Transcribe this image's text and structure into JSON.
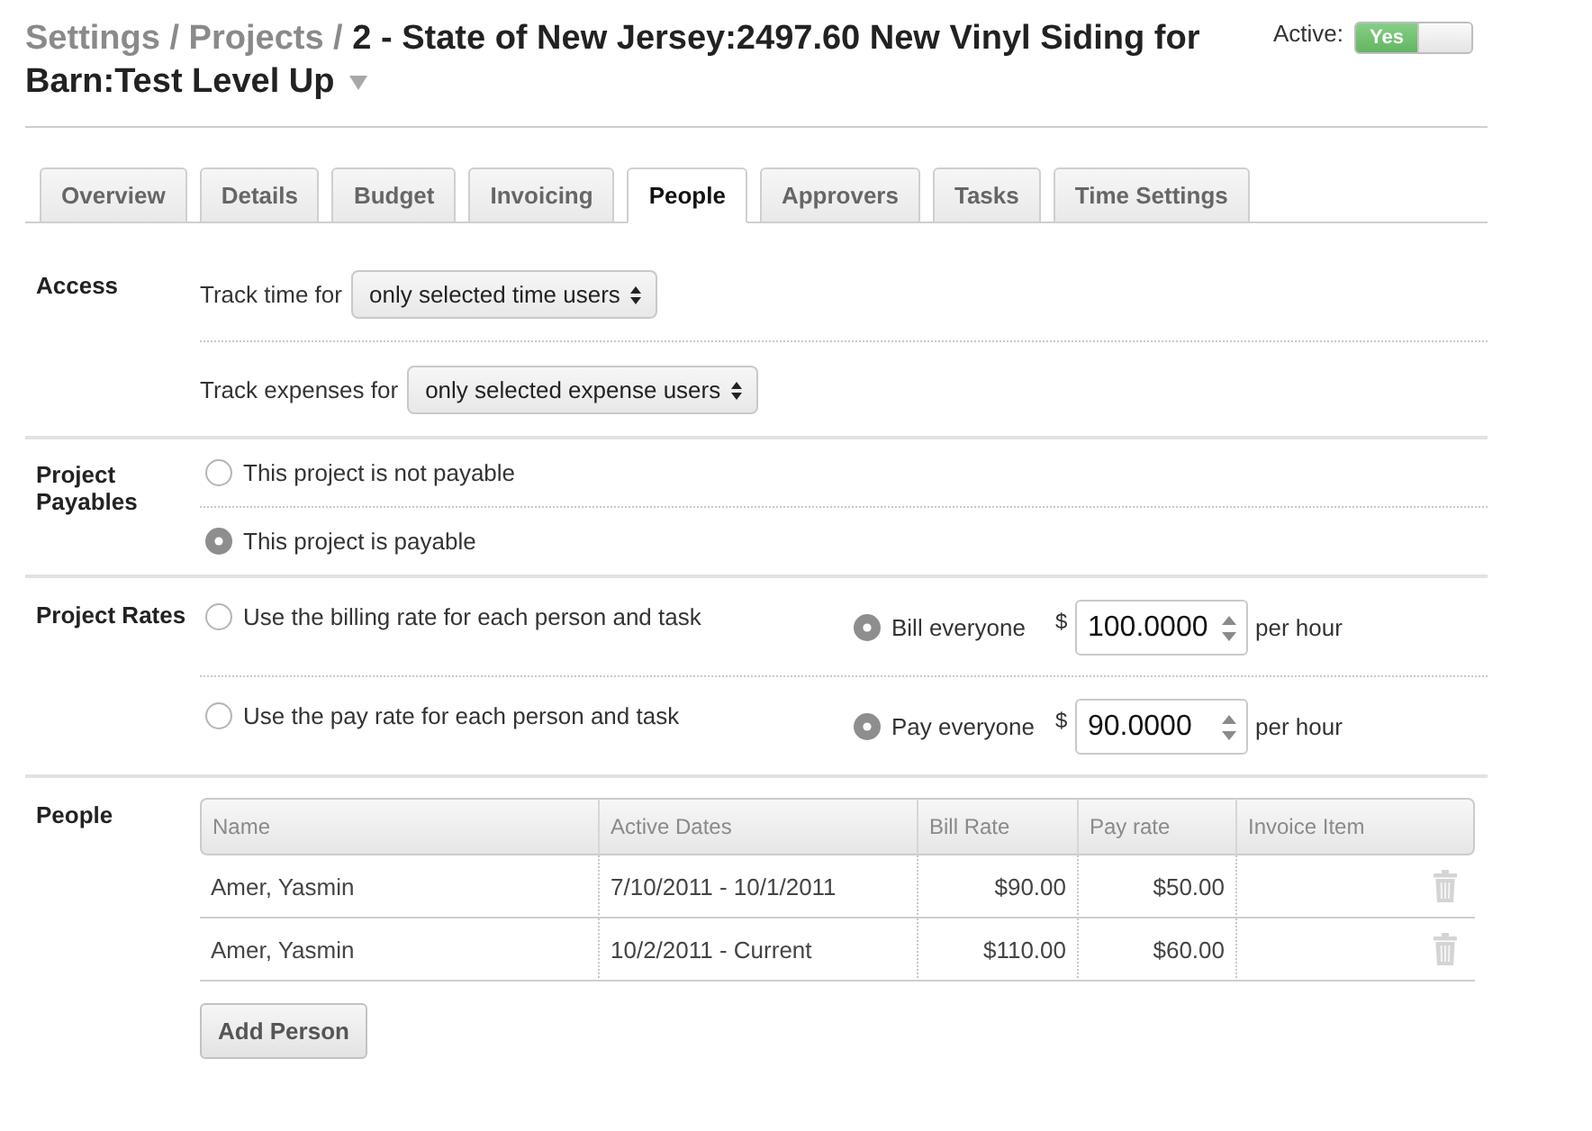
{
  "header": {
    "breadcrumb": [
      {
        "label": "Settings",
        "separator": "/"
      },
      {
        "label": "Projects",
        "separator": "/"
      }
    ],
    "title": "2 - State of New Jersey:2497.60 New Vinyl Siding for Barn:Test Level Up",
    "active": {
      "label": "Active:",
      "on": true,
      "on_text": "Yes"
    }
  },
  "tabs": [
    {
      "label": "Overview",
      "selected": false
    },
    {
      "label": "Details",
      "selected": false
    },
    {
      "label": "Budget",
      "selected": false
    },
    {
      "label": "Invoicing",
      "selected": false
    },
    {
      "label": "People",
      "selected": true
    },
    {
      "label": "Approvers",
      "selected": false
    },
    {
      "label": "Tasks",
      "selected": false
    },
    {
      "label": "Time Settings",
      "selected": false
    }
  ],
  "access": {
    "label": "Access",
    "rows": [
      {
        "label": "Track time for",
        "value": "only selected time users"
      },
      {
        "label": "Track expenses for",
        "value": "only selected expense users"
      }
    ]
  },
  "payables": {
    "label": "Project Payables",
    "options": [
      {
        "label": "This project is not payable",
        "selected": false
      },
      {
        "label": "This project is payable",
        "selected": true
      }
    ]
  },
  "rates": {
    "label": "Project Rates",
    "rows": [
      {
        "per_person": {
          "label": "Use the billing rate for each person and task",
          "selected": false
        },
        "flat": {
          "label": "Bill everyone",
          "selected": true,
          "currency": "$",
          "value": "100.0000",
          "unit": "per hour"
        }
      },
      {
        "per_person": {
          "label": "Use the pay rate for each person and task",
          "selected": false
        },
        "flat": {
          "label": "Pay everyone",
          "selected": true,
          "currency": "$",
          "value": "90.0000",
          "unit": "per hour"
        }
      }
    ]
  },
  "people": {
    "label": "People",
    "table": {
      "columns": [
        "Name",
        "Active Dates",
        "Bill Rate",
        "Pay rate",
        "Invoice Item"
      ],
      "rows": [
        {
          "cells": [
            "Amer, Yasmin",
            "7/10/2011 - 10/1/2011",
            "$90.00",
            "$50.00"
          ]
        },
        {
          "cells": [
            "Amer, Yasmin",
            "10/2/2011 - Current",
            "$110.00",
            "$60.00"
          ]
        }
      ]
    },
    "add_button": "Add Person"
  }
}
